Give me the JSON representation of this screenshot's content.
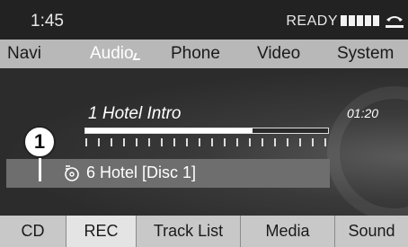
{
  "status": {
    "time": "1:45",
    "ready": "READY",
    "signal_icon": "signal-bars-icon",
    "phone_icon": "phone-icon"
  },
  "menu": [
    {
      "label": "Navi",
      "active": false
    },
    {
      "label": "Audio",
      "active": true
    },
    {
      "label": "Phone",
      "active": false
    },
    {
      "label": "Video",
      "active": false
    },
    {
      "label": "System",
      "active": false
    }
  ],
  "player": {
    "track_title": "1 Hotel Intro",
    "elapsed": "01:20",
    "progress": 0.69,
    "album": "6 Hotel [Disc 1]",
    "album_icon": "cd-disc-icon"
  },
  "callout": {
    "number": "1"
  },
  "softkeys": [
    {
      "label": "CD",
      "active": false
    },
    {
      "label": "REC",
      "active": true
    },
    {
      "label": "Track List",
      "active": false
    },
    {
      "label": "Media",
      "active": false
    },
    {
      "label": "Sound",
      "active": false
    }
  ]
}
